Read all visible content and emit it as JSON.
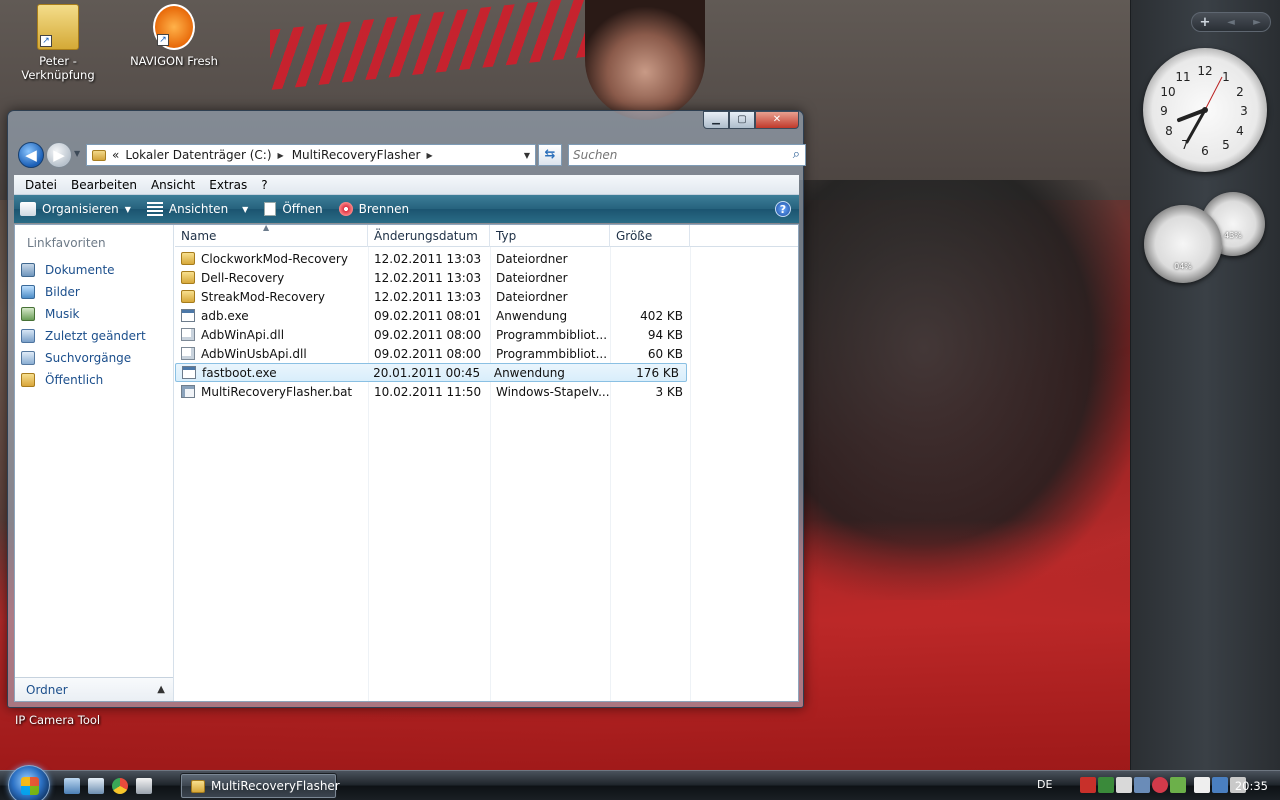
{
  "desktop": {
    "icons": [
      {
        "label": "Peter - Verknüpfung",
        "icon": "folder-shortcut-icon"
      },
      {
        "label": "NAVIGON Fresh",
        "icon": "navigon-icon"
      },
      {
        "label": "IP Camera Tool",
        "icon": "camera-icon"
      }
    ]
  },
  "sidebar": {
    "controls": {
      "add": "+",
      "prev": "◄",
      "next": "►"
    },
    "cpu_meter": {
      "value": "04%"
    },
    "memory_meter": {
      "value": "43%"
    }
  },
  "window": {
    "caption": {
      "minimize": "▁",
      "maximize": "▢",
      "close": "✕"
    },
    "address": {
      "prefix": "«",
      "segments": [
        "Lokaler Datenträger (C:)",
        "MultiRecoveryFlasher"
      ]
    },
    "search": {
      "placeholder": "Suchen"
    },
    "menu": [
      "Datei",
      "Bearbeiten",
      "Ansicht",
      "Extras",
      "?"
    ],
    "commands": [
      {
        "label": "Organisieren",
        "has_dropdown": true
      },
      {
        "label": "Ansichten",
        "has_dropdown": true
      },
      {
        "label": "Öffnen",
        "has_dropdown": false
      },
      {
        "label": "Brennen",
        "has_dropdown": false
      }
    ],
    "help_label": "?",
    "navigation_pane": {
      "title": "Linkfavoriten",
      "items": [
        {
          "label": "Dokumente",
          "icon": "documents-icon"
        },
        {
          "label": "Bilder",
          "icon": "pictures-icon"
        },
        {
          "label": "Musik",
          "icon": "music-icon"
        },
        {
          "label": "Zuletzt geändert",
          "icon": "recent-icon"
        },
        {
          "label": "Suchvorgänge",
          "icon": "searches-icon"
        },
        {
          "label": "Öffentlich",
          "icon": "public-folder-icon"
        }
      ],
      "footer": "Ordner"
    },
    "columns": [
      "Name",
      "Änderungsdatum",
      "Typ",
      "Größe"
    ],
    "files": [
      {
        "name": "ClockworkMod-Recovery",
        "date": "12.02.2011 13:03",
        "type": "Dateiordner",
        "size": "",
        "kind": "folder"
      },
      {
        "name": "Dell-Recovery",
        "date": "12.02.2011 13:03",
        "type": "Dateiordner",
        "size": "",
        "kind": "folder"
      },
      {
        "name": "StreakMod-Recovery",
        "date": "12.02.2011 13:03",
        "type": "Dateiordner",
        "size": "",
        "kind": "folder"
      },
      {
        "name": "adb.exe",
        "date": "09.02.2011 08:01",
        "type": "Anwendung",
        "size": "402 KB",
        "kind": "exe"
      },
      {
        "name": "AdbWinApi.dll",
        "date": "09.02.2011 08:00",
        "type": "Programmbibliot...",
        "size": "94 KB",
        "kind": "dll"
      },
      {
        "name": "AdbWinUsbApi.dll",
        "date": "09.02.2011 08:00",
        "type": "Programmbibliot...",
        "size": "60 KB",
        "kind": "dll"
      },
      {
        "name": "fastboot.exe",
        "date": "20.01.2011 00:45",
        "type": "Anwendung",
        "size": "176 KB",
        "kind": "exe",
        "selected": true
      },
      {
        "name": "MultiRecoveryFlasher.bat",
        "date": "10.02.2011 11:50",
        "type": "Windows-Stapelv...",
        "size": "3 KB",
        "kind": "bat"
      }
    ]
  },
  "taskbar": {
    "task": "MultiRecoveryFlasher",
    "language": "DE",
    "time": "20:35"
  },
  "colors": {
    "command_bar": "#26627d",
    "link_text": "#1c4f8c",
    "selection": "#d9eefb"
  }
}
